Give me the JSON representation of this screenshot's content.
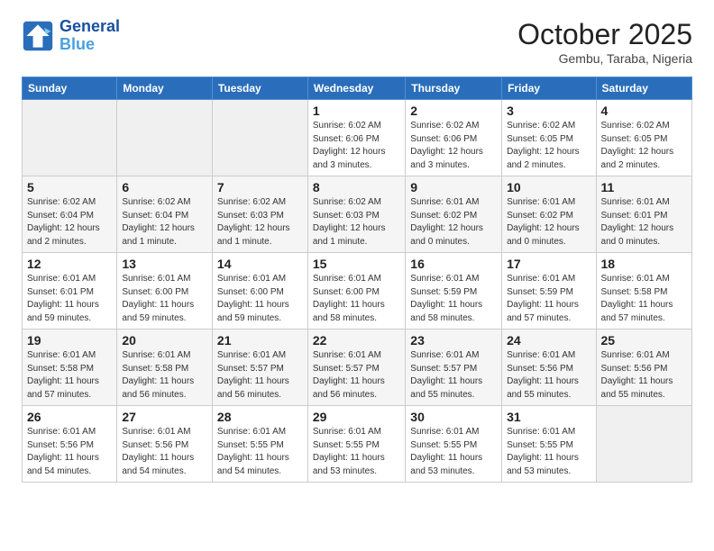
{
  "header": {
    "logo_line1": "General",
    "logo_line2": "Blue",
    "month": "October 2025",
    "location": "Gembu, Taraba, Nigeria"
  },
  "days_of_week": [
    "Sunday",
    "Monday",
    "Tuesday",
    "Wednesday",
    "Thursday",
    "Friday",
    "Saturday"
  ],
  "weeks": [
    [
      {
        "day": "",
        "info": ""
      },
      {
        "day": "",
        "info": ""
      },
      {
        "day": "",
        "info": ""
      },
      {
        "day": "1",
        "info": "Sunrise: 6:02 AM\nSunset: 6:06 PM\nDaylight: 12 hours\nand 3 minutes."
      },
      {
        "day": "2",
        "info": "Sunrise: 6:02 AM\nSunset: 6:06 PM\nDaylight: 12 hours\nand 3 minutes."
      },
      {
        "day": "3",
        "info": "Sunrise: 6:02 AM\nSunset: 6:05 PM\nDaylight: 12 hours\nand 2 minutes."
      },
      {
        "day": "4",
        "info": "Sunrise: 6:02 AM\nSunset: 6:05 PM\nDaylight: 12 hours\nand 2 minutes."
      }
    ],
    [
      {
        "day": "5",
        "info": "Sunrise: 6:02 AM\nSunset: 6:04 PM\nDaylight: 12 hours\nand 2 minutes."
      },
      {
        "day": "6",
        "info": "Sunrise: 6:02 AM\nSunset: 6:04 PM\nDaylight: 12 hours\nand 1 minute."
      },
      {
        "day": "7",
        "info": "Sunrise: 6:02 AM\nSunset: 6:03 PM\nDaylight: 12 hours\nand 1 minute."
      },
      {
        "day": "8",
        "info": "Sunrise: 6:02 AM\nSunset: 6:03 PM\nDaylight: 12 hours\nand 1 minute."
      },
      {
        "day": "9",
        "info": "Sunrise: 6:01 AM\nSunset: 6:02 PM\nDaylight: 12 hours\nand 0 minutes."
      },
      {
        "day": "10",
        "info": "Sunrise: 6:01 AM\nSunset: 6:02 PM\nDaylight: 12 hours\nand 0 minutes."
      },
      {
        "day": "11",
        "info": "Sunrise: 6:01 AM\nSunset: 6:01 PM\nDaylight: 12 hours\nand 0 minutes."
      }
    ],
    [
      {
        "day": "12",
        "info": "Sunrise: 6:01 AM\nSunset: 6:01 PM\nDaylight: 11 hours\nand 59 minutes."
      },
      {
        "day": "13",
        "info": "Sunrise: 6:01 AM\nSunset: 6:00 PM\nDaylight: 11 hours\nand 59 minutes."
      },
      {
        "day": "14",
        "info": "Sunrise: 6:01 AM\nSunset: 6:00 PM\nDaylight: 11 hours\nand 59 minutes."
      },
      {
        "day": "15",
        "info": "Sunrise: 6:01 AM\nSunset: 6:00 PM\nDaylight: 11 hours\nand 58 minutes."
      },
      {
        "day": "16",
        "info": "Sunrise: 6:01 AM\nSunset: 5:59 PM\nDaylight: 11 hours\nand 58 minutes."
      },
      {
        "day": "17",
        "info": "Sunrise: 6:01 AM\nSunset: 5:59 PM\nDaylight: 11 hours\nand 57 minutes."
      },
      {
        "day": "18",
        "info": "Sunrise: 6:01 AM\nSunset: 5:58 PM\nDaylight: 11 hours\nand 57 minutes."
      }
    ],
    [
      {
        "day": "19",
        "info": "Sunrise: 6:01 AM\nSunset: 5:58 PM\nDaylight: 11 hours\nand 57 minutes."
      },
      {
        "day": "20",
        "info": "Sunrise: 6:01 AM\nSunset: 5:58 PM\nDaylight: 11 hours\nand 56 minutes."
      },
      {
        "day": "21",
        "info": "Sunrise: 6:01 AM\nSunset: 5:57 PM\nDaylight: 11 hours\nand 56 minutes."
      },
      {
        "day": "22",
        "info": "Sunrise: 6:01 AM\nSunset: 5:57 PM\nDaylight: 11 hours\nand 56 minutes."
      },
      {
        "day": "23",
        "info": "Sunrise: 6:01 AM\nSunset: 5:57 PM\nDaylight: 11 hours\nand 55 minutes."
      },
      {
        "day": "24",
        "info": "Sunrise: 6:01 AM\nSunset: 5:56 PM\nDaylight: 11 hours\nand 55 minutes."
      },
      {
        "day": "25",
        "info": "Sunrise: 6:01 AM\nSunset: 5:56 PM\nDaylight: 11 hours\nand 55 minutes."
      }
    ],
    [
      {
        "day": "26",
        "info": "Sunrise: 6:01 AM\nSunset: 5:56 PM\nDaylight: 11 hours\nand 54 minutes."
      },
      {
        "day": "27",
        "info": "Sunrise: 6:01 AM\nSunset: 5:56 PM\nDaylight: 11 hours\nand 54 minutes."
      },
      {
        "day": "28",
        "info": "Sunrise: 6:01 AM\nSunset: 5:55 PM\nDaylight: 11 hours\nand 54 minutes."
      },
      {
        "day": "29",
        "info": "Sunrise: 6:01 AM\nSunset: 5:55 PM\nDaylight: 11 hours\nand 53 minutes."
      },
      {
        "day": "30",
        "info": "Sunrise: 6:01 AM\nSunset: 5:55 PM\nDaylight: 11 hours\nand 53 minutes."
      },
      {
        "day": "31",
        "info": "Sunrise: 6:01 AM\nSunset: 5:55 PM\nDaylight: 11 hours\nand 53 minutes."
      },
      {
        "day": "",
        "info": ""
      }
    ]
  ]
}
